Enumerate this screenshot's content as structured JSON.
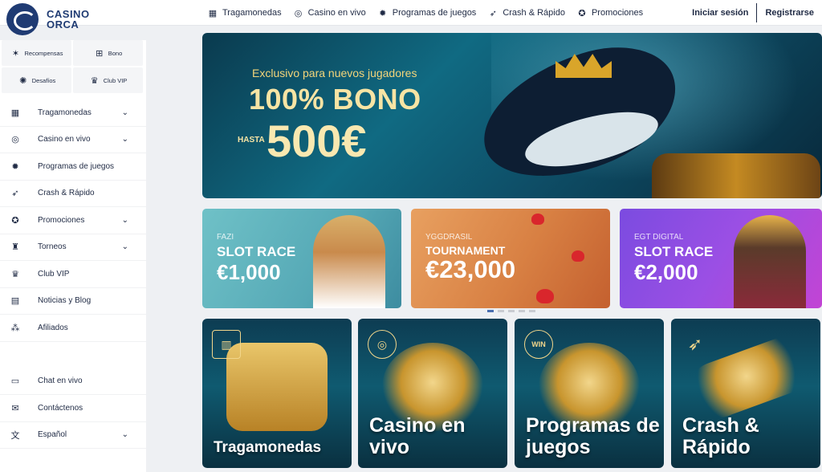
{
  "brand": {
    "line1": "CASINO",
    "line2": "ORCA"
  },
  "topnav": [
    {
      "label": "Tragamonedas",
      "icon": "slot-machine-icon",
      "glyph": "▦"
    },
    {
      "label": "Casino en vivo",
      "icon": "roulette-icon",
      "glyph": "◎"
    },
    {
      "label": "Programas de juegos",
      "icon": "game-show-icon",
      "glyph": "✹"
    },
    {
      "label": "Crash & Rápido",
      "icon": "rocket-icon",
      "glyph": "➶"
    },
    {
      "label": "Promociones",
      "icon": "promotions-icon",
      "glyph": "✪"
    }
  ],
  "auth": {
    "login": "Iniciar sesión",
    "register": "Registrarse"
  },
  "quick": [
    {
      "label": "Recompensas",
      "icon": "rewards-icon",
      "glyph": "✶"
    },
    {
      "label": "Bono",
      "icon": "gift-icon",
      "glyph": "⊞"
    },
    {
      "label": "Desafíos",
      "icon": "challenges-icon",
      "glyph": "✺"
    },
    {
      "label": "Club VIP",
      "icon": "vip-crown-icon",
      "glyph": "♛"
    }
  ],
  "menu": [
    {
      "label": "Tragamonedas",
      "icon": "slot-machine-icon",
      "glyph": "▦",
      "chevron": true
    },
    {
      "label": "Casino en vivo",
      "icon": "roulette-icon",
      "glyph": "◎",
      "chevron": true
    },
    {
      "label": "Programas de juegos",
      "icon": "game-show-icon",
      "glyph": "✹",
      "chevron": false
    },
    {
      "label": "Crash & Rápido",
      "icon": "rocket-icon",
      "glyph": "➶",
      "chevron": false
    },
    {
      "label": "Promociones",
      "icon": "promotions-icon",
      "glyph": "✪",
      "chevron": true
    },
    {
      "label": "Torneos",
      "icon": "trophy-icon",
      "glyph": "♜",
      "chevron": true
    },
    {
      "label": "Club VIP",
      "icon": "vip-crown-icon",
      "glyph": "♛",
      "chevron": false
    },
    {
      "label": "Noticias y Blog",
      "icon": "news-icon",
      "glyph": "▤",
      "chevron": false
    },
    {
      "label": "Afiliados",
      "icon": "affiliates-icon",
      "glyph": "⁂",
      "chevron": false
    }
  ],
  "menu_bottom": [
    {
      "label": "Chat en vivo",
      "icon": "chat-icon",
      "glyph": "▭",
      "chevron": false
    },
    {
      "label": "Contáctenos",
      "icon": "contact-icon",
      "glyph": "✉",
      "chevron": false
    },
    {
      "label": "Español",
      "icon": "language-icon",
      "glyph": "文",
      "chevron": true
    }
  ],
  "hero": {
    "subtitle": "Exclusivo para nuevos jugadores",
    "headline": "100% BONO",
    "upto": "HASTA",
    "amount": "500€"
  },
  "promos": [
    {
      "provider": "FAZI",
      "title": "SLOT RACE",
      "amount": "€1,000"
    },
    {
      "provider": "YGGDRASIL",
      "title": "TOURNAMENT",
      "amount": "€23,000"
    },
    {
      "provider": "EGT DIGITAL",
      "title": "SLOT RACE",
      "amount": "€2,000"
    }
  ],
  "carousel": {
    "slides": 5,
    "active": 1
  },
  "categories": [
    {
      "label": "Tragamonedas",
      "icon": "slot-machine-icon",
      "glyph": "▥"
    },
    {
      "label": "Casino en vivo",
      "icon": "roulette-icon",
      "glyph": "◎"
    },
    {
      "label": "Programas de juegos",
      "icon": "win-wheel-icon",
      "glyph": "WIN"
    },
    {
      "label": "Crash & Rápido",
      "icon": "rocket-icon",
      "glyph": "➶"
    }
  ],
  "colors": {
    "brand": "#1f3b73",
    "text": "#1f2a44",
    "accent_gold": "#f3d57a"
  }
}
